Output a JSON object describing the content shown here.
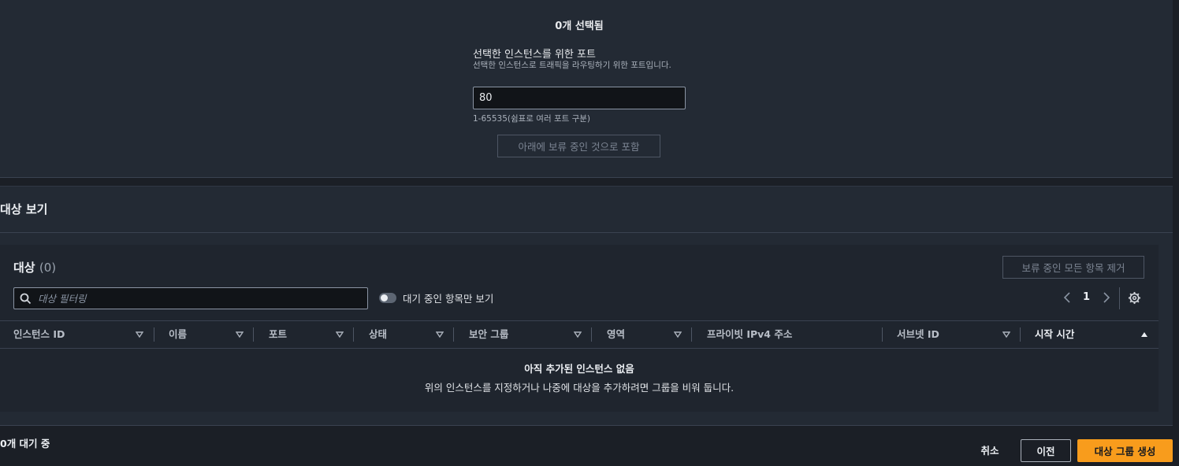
{
  "port_section": {
    "selected_count": "0개 선택됨",
    "label": "선택한 인스턴스를 위한 포트",
    "description": "선택한 인스턴스로 트래픽을 라우팅하기 위한 포트입니다.",
    "value": "80",
    "hint": "1-65535(쉼표로 여러 포트 구분)",
    "include_button": "아래에 보류 중인 것으로 포함"
  },
  "view_targets": {
    "title": "대상 보기",
    "card_title": "대상",
    "card_count": "(0)",
    "remove_all_button": "보류 중인 모든 항목 제거",
    "filter_placeholder": "대상 필터링",
    "toggle_label": "대기 중인 항목만 보기",
    "toggle_on": false,
    "page": "1",
    "columns": [
      {
        "label": "인스턴스 ID",
        "sort": "none"
      },
      {
        "label": "이름",
        "sort": "none"
      },
      {
        "label": "포트",
        "sort": "none"
      },
      {
        "label": "상태",
        "sort": "none"
      },
      {
        "label": "보안 그룹",
        "sort": "none"
      },
      {
        "label": "영역",
        "sort": "none"
      },
      {
        "label": "프라이빗 IPv4 주소",
        "sort": "none"
      },
      {
        "label": "서브넷 ID",
        "sort": "none"
      },
      {
        "label": "시작 시간",
        "sort": "ascending"
      }
    ],
    "empty_title": "아직 추가된 인스턴스 없음",
    "empty_description": "위의 인스턴스를 지정하거나 나중에 대상을 추가하려면 그룹을 비워 둡니다."
  },
  "footer": {
    "pending_count": "0개 대기 중",
    "cancel": "취소",
    "previous": "이전",
    "create": "대상 그룹 생성"
  },
  "colors": {
    "accent": "#f89c1c",
    "panel": "#232a34",
    "background": "#1b1f26"
  }
}
